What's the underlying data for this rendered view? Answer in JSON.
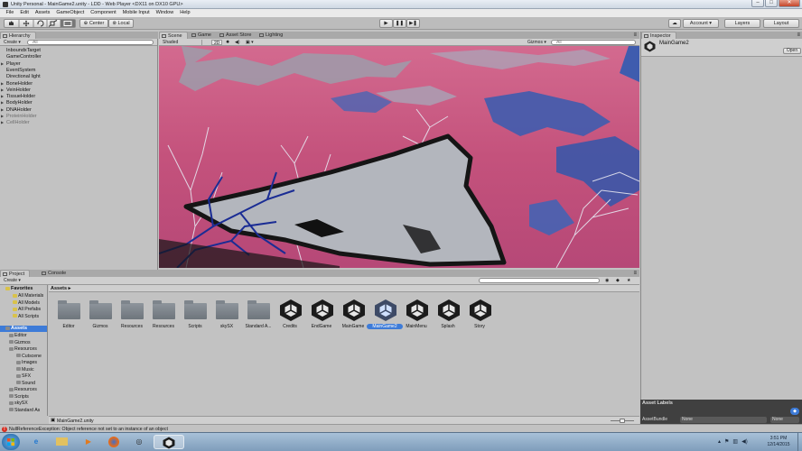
{
  "window": {
    "title": "Unity Personal - MainGame2.unity - LDD - Web Player <DX11 on DX10 GPU>",
    "minimize": "–",
    "maximize": "□",
    "close": "✕"
  },
  "menu": [
    "File",
    "Edit",
    "Assets",
    "GameObject",
    "Component",
    "Mobile Input",
    "Window",
    "Help"
  ],
  "toolbar": {
    "center_label": "Center",
    "local_label": "Local",
    "play_icon": "▶",
    "pause_icon": "❚❚",
    "step_icon": "▶❚",
    "account_label": "Account ▾",
    "layers_label": "Layers",
    "layout_label": "Layout"
  },
  "hierarchy": {
    "tab": "Hierarchy",
    "create": "Create ▾",
    "search_placeholder": "All",
    "items": [
      {
        "label": "InboundxTarget",
        "dim": false,
        "arrow": false
      },
      {
        "label": "GameController",
        "dim": false,
        "arrow": false
      },
      {
        "label": "Player",
        "dim": false,
        "arrow": true
      },
      {
        "label": "EventSystem",
        "dim": false,
        "arrow": false
      },
      {
        "label": "Directional light",
        "dim": false,
        "arrow": false
      },
      {
        "label": "BoneHolder",
        "dim": false,
        "arrow": true
      },
      {
        "label": "VeinHolder",
        "dim": false,
        "arrow": true
      },
      {
        "label": "TissueHolder",
        "dim": false,
        "arrow": true
      },
      {
        "label": "BodyHolder",
        "dim": false,
        "arrow": true
      },
      {
        "label": "DNAHolder",
        "dim": false,
        "arrow": true
      },
      {
        "label": "ProteinHolder",
        "dim": true,
        "arrow": true
      },
      {
        "label": "CellHolder",
        "dim": true,
        "arrow": true
      }
    ]
  },
  "scene": {
    "tabs": [
      "Scene",
      "Game",
      "Asset Store",
      "Lighting"
    ],
    "shading": "Shaded",
    "mode_2d": "2D",
    "gizmos": "Gizmos ▾",
    "search_placeholder": "All"
  },
  "inspector": {
    "tab": "Inspector",
    "object_name": "MainGame2",
    "open_button": "Open"
  },
  "project": {
    "tabs": [
      "Project",
      "Console"
    ],
    "create": "Create ▾",
    "crumb": "Assets ▸",
    "favorites": {
      "title": "Favorites",
      "items": [
        "All Materials",
        "All Models",
        "All Prefabs",
        "All Scripts"
      ]
    },
    "tree_root": "Assets",
    "tree": [
      {
        "label": "Editor",
        "indent": 1
      },
      {
        "label": "Gizmos",
        "indent": 1
      },
      {
        "label": "Resources",
        "indent": 1
      },
      {
        "label": "Cutscene",
        "indent": 2
      },
      {
        "label": "Images",
        "indent": 2
      },
      {
        "label": "Music",
        "indent": 2
      },
      {
        "label": "SFX",
        "indent": 2
      },
      {
        "label": "Sound",
        "indent": 2
      },
      {
        "label": "Resources",
        "indent": 1
      },
      {
        "label": "Scripts",
        "indent": 1
      },
      {
        "label": "skySX",
        "indent": 1
      },
      {
        "label": "Standard As",
        "indent": 1
      }
    ],
    "assets": [
      {
        "label": "Editor",
        "kind": "folder",
        "selected": false
      },
      {
        "label": "Gizmos",
        "kind": "folder",
        "selected": false
      },
      {
        "label": "Resources",
        "kind": "folder",
        "selected": false
      },
      {
        "label": "Resources",
        "kind": "folder",
        "selected": false
      },
      {
        "label": "Scripts",
        "kind": "folder",
        "selected": false
      },
      {
        "label": "skySX",
        "kind": "folder",
        "selected": false
      },
      {
        "label": "Standard A...",
        "kind": "folder",
        "selected": false
      },
      {
        "label": "Credits",
        "kind": "unity",
        "selected": false
      },
      {
        "label": "EndGame",
        "kind": "unity",
        "selected": false
      },
      {
        "label": "MainGame",
        "kind": "unity",
        "selected": false
      },
      {
        "label": "MainGame2",
        "kind": "unity",
        "selected": true
      },
      {
        "label": "MainMenu",
        "kind": "unity",
        "selected": false
      },
      {
        "label": "Splash",
        "kind": "unity",
        "selected": false
      },
      {
        "label": "Story",
        "kind": "unity",
        "selected": false
      }
    ],
    "path": "MainGame2.unity"
  },
  "asset_labels": {
    "title": "Asset Labels",
    "bundle_label": "AssetBundle",
    "bundle_value": "None",
    "variant_value": "None"
  },
  "status": {
    "message": "NullReferenceException: Object reference not set to an instance of an object"
  },
  "taskbar": {
    "time": "3:51 PM",
    "date": "12/14/2015"
  },
  "colors": {
    "accent": "#3d7bd8",
    "scene_pink": "#c5577f",
    "error": "#d52b1e"
  }
}
